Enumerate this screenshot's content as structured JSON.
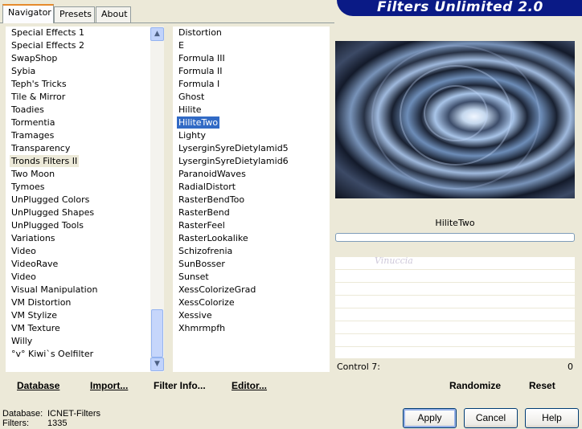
{
  "tabs": [
    {
      "label": "Navigator"
    },
    {
      "label": "Presets"
    },
    {
      "label": "About"
    }
  ],
  "banner": {
    "title": "Filters Unlimited 2.0"
  },
  "categories": {
    "items": [
      "Special Effects 1",
      "Special Effects 2",
      "SwapShop",
      "Sybia",
      "Teph's Tricks",
      "Tile & Mirror",
      "Toadies",
      "Tormentia",
      "Tramages",
      "Transparency",
      "Tronds Filters II",
      "Two Moon",
      "Tymoes",
      "UnPlugged Colors",
      "UnPlugged Shapes",
      "UnPlugged Tools",
      "Variations",
      "Video",
      "VideoRave",
      "Video",
      "Visual Manipulation",
      "VM Distortion",
      "VM Stylize",
      "VM Texture",
      "Willy",
      "°v° Kiwi`s Oelfilter"
    ],
    "selected": "Tronds Filters II"
  },
  "filters": {
    "items": [
      "Distortion",
      "E",
      "Formula III",
      "Formula II",
      "Formula I",
      "Ghost",
      "Hilite",
      "HiliteTwo",
      "Lighty",
      "LyserginSyreDietylamid5",
      "LyserginSyreDietylamid6",
      "ParanoidWaves",
      "RadialDistort",
      "RasterBendToo",
      "RasterBend",
      "RasterFeel",
      "RasterLookalike",
      "Schizofrenia",
      "SunBosser",
      "Sunset",
      "XessColorizeGrad",
      "XessColorize",
      "Xessive",
      "Xhmrmpfh"
    ],
    "selected": "HiliteTwo"
  },
  "preview": {
    "filter_name": "HiliteTwo",
    "watermark": "Vinuccia"
  },
  "control": {
    "label": "Control 7:",
    "value": "0"
  },
  "left_buttons": {
    "database": "Database",
    "import": "Import...",
    "filter_info": "Filter Info...",
    "editor": "Editor..."
  },
  "right_buttons": {
    "randomize": "Randomize",
    "reset": "Reset"
  },
  "status": {
    "database_label": "Database:",
    "database_value": "ICNET-Filters",
    "filters_label": "Filters:",
    "filters_value": "1335"
  },
  "dialog_buttons": {
    "apply": "Apply",
    "cancel": "Cancel",
    "help": "Help"
  },
  "colors": {
    "selection": "#316ac5",
    "banner": "#0a1a86",
    "face": "#ece9d8"
  }
}
